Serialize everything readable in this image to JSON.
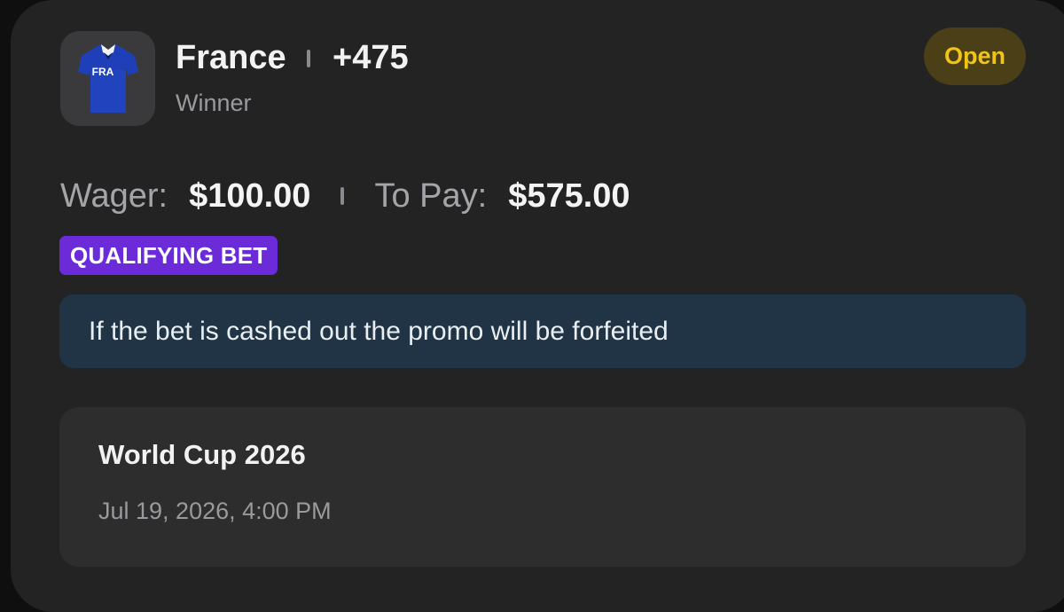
{
  "bet": {
    "team_logo_icon": "france-jersey-icon",
    "jersey_text": "FRA",
    "team": "France",
    "odds": "+475",
    "market": "Winner",
    "status": "Open"
  },
  "amounts": {
    "wager_label": "Wager:",
    "wager_value": "$100.00",
    "to_pay_label": "To Pay:",
    "to_pay_value": "$575.00"
  },
  "promo": {
    "badge": "QUALIFYING BET",
    "notice": "If the bet is cashed out the promo will be forfeited"
  },
  "event": {
    "title": "World Cup 2026",
    "date": "Jul 19, 2026, 4:00 PM"
  },
  "colors": {
    "background": "#0f0f10",
    "card": "#232324",
    "status_text": "#f0c419",
    "status_bg": "#4a3f17",
    "promo_badge": "#6b2bd9",
    "notice_bg": "#203445",
    "event_bg": "#2d2d2e"
  }
}
